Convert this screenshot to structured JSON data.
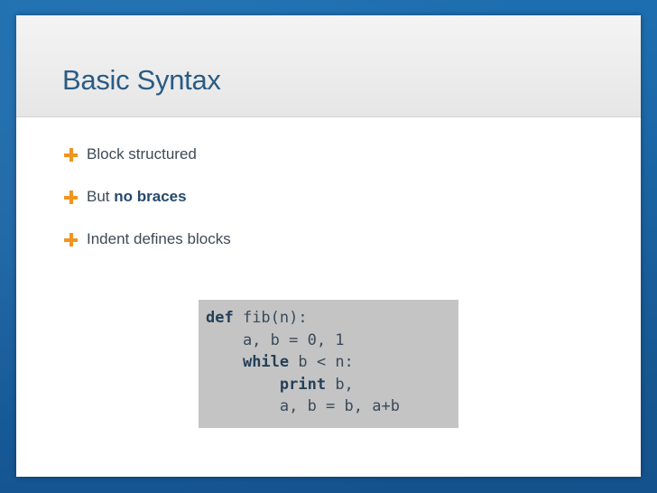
{
  "slide": {
    "title": "Basic Syntax",
    "bullets": {
      "item1": "Block structured",
      "item2_prefix": "But ",
      "item2_bold": "no braces",
      "item3": "Indent defines blocks"
    },
    "code": {
      "line1_kw": "def",
      "line1_rest": " fib(n):",
      "line2": "    a, b = 0, 1",
      "line3_indent": "    ",
      "line3_kw": "while",
      "line3_rest": " b < n:",
      "line4_indent": "        ",
      "line4_kw": "print",
      "line4_rest": " b,",
      "line5": "        a, b = b, a+b"
    }
  },
  "colors": {
    "background": "#1a64a4",
    "title": "#2a5b84",
    "bullet_marker": "#f19421",
    "code_background": "#c4c4c4"
  },
  "icons": {
    "bullet": "plus-icon"
  }
}
